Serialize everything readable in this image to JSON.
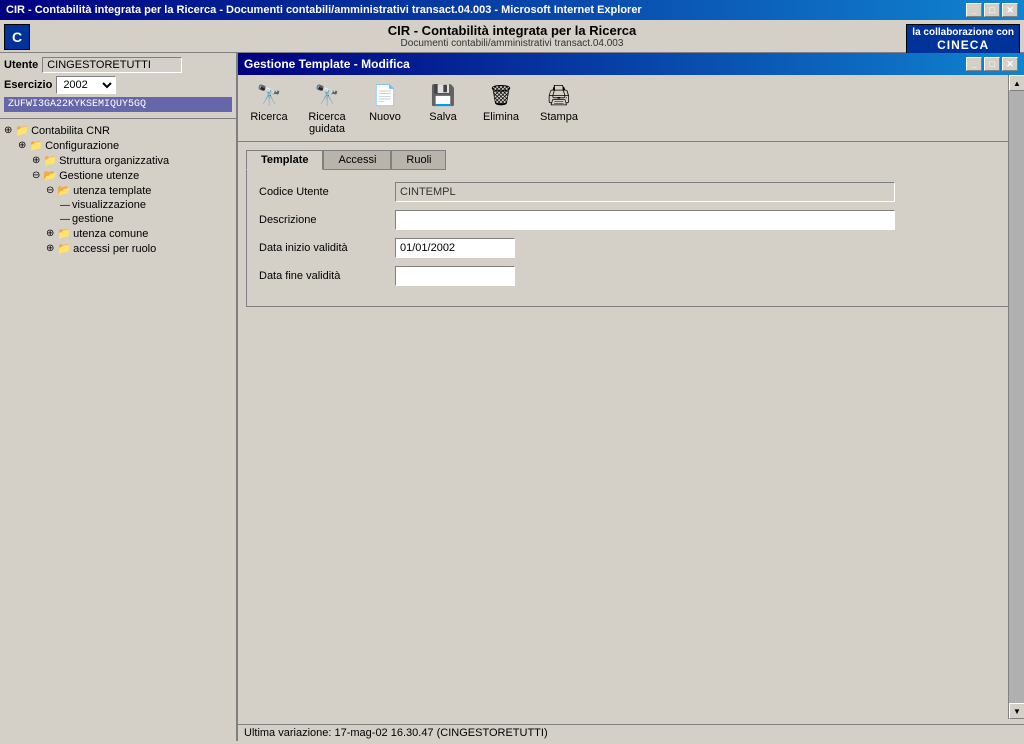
{
  "window": {
    "title": "CIR - Contabilità integrata per la Ricerca - Documenti contabili/amministrativi transact.04.003 - Microsoft Internet Explorer",
    "title_short": "CIR - Contabilità integrata per la Ricerca",
    "subtitle": "Documenti contabili/amministrativi transact.04.003",
    "cineca": "la collaborazione con",
    "cineca_brand": "CINECA"
  },
  "header": {
    "app_title": "CIR - Contabilità integrata per la Ricerca",
    "app_subtitle": "Documenti contabili/amministrativi transact.04.003"
  },
  "left_panel": {
    "user_label": "Utente",
    "user_value": "CINGESTORETUTTI",
    "exercise_label": "Esercizio",
    "exercise_value": "2002",
    "hash_code": "ZUFWI3GA22KYKSEMIQUY5GQ",
    "tree": {
      "items": [
        {
          "level": 1,
          "label": "Contabilita CNR",
          "type": "root",
          "icon": "⊕",
          "folder": true
        },
        {
          "level": 2,
          "label": "Configurazione",
          "type": "folder",
          "icon": "⊕",
          "folder": true
        },
        {
          "level": 3,
          "label": "Struttura organizzativa",
          "type": "folder",
          "icon": "⊕",
          "folder": true
        },
        {
          "level": 3,
          "label": "Gestione utenze",
          "type": "folder",
          "icon": "⊖",
          "folder": true
        },
        {
          "level": 4,
          "label": "utenza template",
          "type": "folder",
          "icon": "⊖",
          "folder": true
        },
        {
          "level": 5,
          "label": "visualizzazione",
          "type": "leaf",
          "icon": "—"
        },
        {
          "level": 5,
          "label": "gestione",
          "type": "leaf",
          "icon": "—"
        },
        {
          "level": 4,
          "label": "utenza comune",
          "type": "folder",
          "icon": "⊕",
          "folder": true
        },
        {
          "level": 4,
          "label": "accessi per ruolo",
          "type": "folder",
          "icon": "⊕",
          "folder": true
        }
      ]
    }
  },
  "toolbar": {
    "buttons": [
      {
        "id": "ricerca",
        "label": "Ricerca",
        "icon": "🔍"
      },
      {
        "id": "ricerca-guidata",
        "label": "Ricerca\nguidata",
        "icon": "🔍"
      },
      {
        "id": "nuovo",
        "label": "Nuovo",
        "icon": "📄"
      },
      {
        "id": "salva",
        "label": "Salva",
        "icon": "💾"
      },
      {
        "id": "elimina",
        "label": "Elimina",
        "icon": "🗑"
      },
      {
        "id": "stampa",
        "label": "Stampa",
        "icon": "🖨"
      }
    ]
  },
  "main_window": {
    "title": "Gestione Template - Modifica"
  },
  "tabs": [
    {
      "id": "template",
      "label": "Template",
      "active": true
    },
    {
      "id": "accessi",
      "label": "Accessi",
      "active": false
    },
    {
      "id": "ruoli",
      "label": "Ruoli",
      "active": false
    }
  ],
  "form": {
    "codice_utente_label": "Codice Utente",
    "codice_utente_value": "CINTEMPL",
    "descrizione_label": "Descrizione",
    "descrizione_value": "",
    "data_inizio_label": "Data inizio validità",
    "data_inizio_value": "01/01/2002",
    "data_fine_label": "Data fine validità",
    "data_fine_value": ""
  },
  "status_bar": {
    "label": "Ultima variazione:",
    "value": "17-mag-02 16.30.47 (CINGESTORETUTTI)"
  }
}
